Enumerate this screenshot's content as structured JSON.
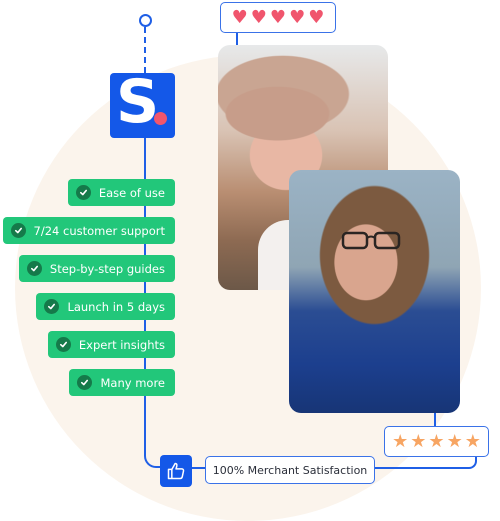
{
  "brand": {
    "logo_letter": "S",
    "primary_color": "#1458e8",
    "accent_dot_color": "#f2566c",
    "background_circle_color": "#fbf4ec"
  },
  "features": [
    {
      "label": "Ease of use",
      "icon": "check-circle-icon"
    },
    {
      "label": "7/24 customer support",
      "icon": "check-circle-icon"
    },
    {
      "label": "Step-by-step guides",
      "icon": "check-circle-icon"
    },
    {
      "label": "Launch in 5 days",
      "icon": "check-circle-icon"
    },
    {
      "label": "Expert insights",
      "icon": "check-circle-icon"
    },
    {
      "label": "Many more",
      "icon": "check-circle-icon"
    }
  ],
  "feature_pill_color": "#22c77a",
  "rating_hearts": {
    "count": 5,
    "max": 5,
    "glyph": "♥",
    "color": "#f0556d"
  },
  "rating_stars": {
    "count": 5,
    "max": 5,
    "glyph": "★",
    "color": "#f7a563"
  },
  "photos": [
    {
      "description": "Laughing woman wearing a wide-brim hat"
    },
    {
      "description": "Smiling woman with glasses in denim shirt"
    }
  ],
  "satisfaction": {
    "icon": "thumbs-up-icon",
    "label": "100% Merchant Satisfaction"
  }
}
